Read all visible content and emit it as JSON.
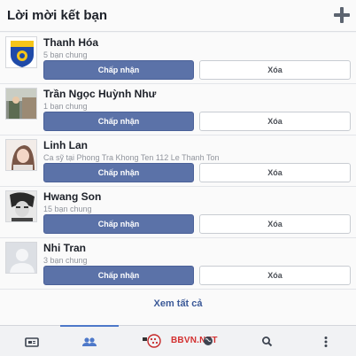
{
  "header": {
    "title": "Lời mời kết bạn",
    "add_icon": "plus-icon"
  },
  "requests": [
    {
      "name": "Thanh Hóa",
      "subtitle": "5 bạn chung",
      "avatar": "logo-avatar",
      "accept_label": "Chấp nhận",
      "delete_label": "Xóa"
    },
    {
      "name": "Trần Ngọc Huỳnh Như",
      "subtitle": "1 bạn chung",
      "avatar": "photo-avatar",
      "accept_label": "Chấp nhận",
      "delete_label": "Xóa"
    },
    {
      "name": "Linh Lan",
      "subtitle": "Ca sỹ tại Phong Tra Khong Ten 112 Le Thanh Ton",
      "avatar": "photo-avatar",
      "accept_label": "Chấp nhận",
      "delete_label": "Xóa"
    },
    {
      "name": "Hwang Son",
      "subtitle": "15 bạn chung",
      "avatar": "photo-avatar",
      "accept_label": "Chấp nhận",
      "delete_label": "Xóa"
    },
    {
      "name": "Nhi Tran",
      "subtitle": "3 bạn chung",
      "avatar": "default-avatar",
      "accept_label": "Chấp nhận",
      "delete_label": "Xóa"
    }
  ],
  "see_all_label": "Xem tất cả",
  "tabbar": {
    "tabs": [
      "news-feed-icon",
      "friend-requests-icon",
      "globe-icon",
      "search-icon",
      "more-icon"
    ],
    "active_tab": "friend-requests-icon"
  },
  "watermark": {
    "text": "BBVN.NET"
  },
  "colors": {
    "accent": "#5b72a8",
    "link": "#3b5998",
    "active_tab": "#4d78c9"
  }
}
